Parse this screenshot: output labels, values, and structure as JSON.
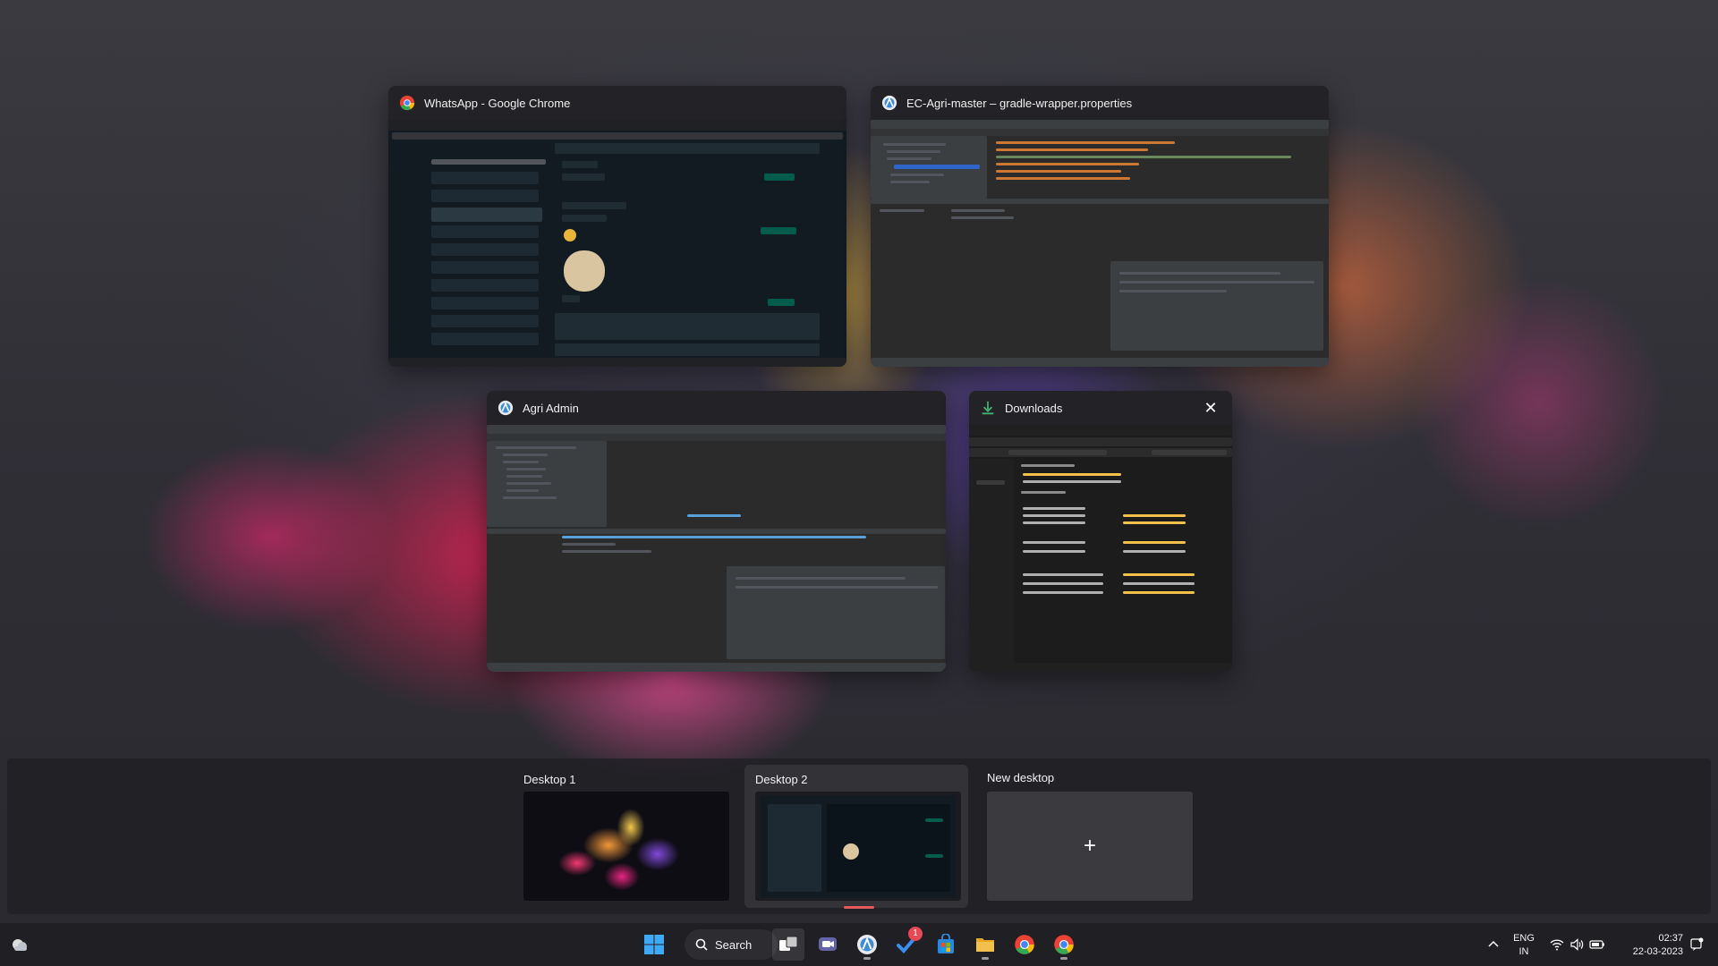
{
  "windows": [
    {
      "title": "WhatsApp - Google Chrome",
      "icon": "chrome-icon"
    },
    {
      "title": "EC-Agri-master – gradle-wrapper.properties",
      "icon": "android-studio-icon"
    },
    {
      "title": "Agri Admin",
      "icon": "android-studio-icon"
    },
    {
      "title": "Downloads",
      "icon": "download-icon",
      "close": "✕"
    }
  ],
  "desktops": {
    "items": [
      {
        "label": "Desktop 1"
      },
      {
        "label": "Desktop 2",
        "active": true
      }
    ],
    "new_label": "New desktop",
    "new_plus": "+"
  },
  "taskbar": {
    "search_label": "Search",
    "todo_badge": "1",
    "language_line1": "ENG",
    "language_line2": "IN",
    "time": "02:37",
    "date": "22-03-2023"
  },
  "colors": {
    "accent": "#0078d4",
    "chrome_red": "#ea4335",
    "chrome_green": "#34a853",
    "chrome_yellow": "#fbbc05",
    "folder_yellow": "#f3c14b",
    "desktop_marker": "#e45a5a"
  }
}
